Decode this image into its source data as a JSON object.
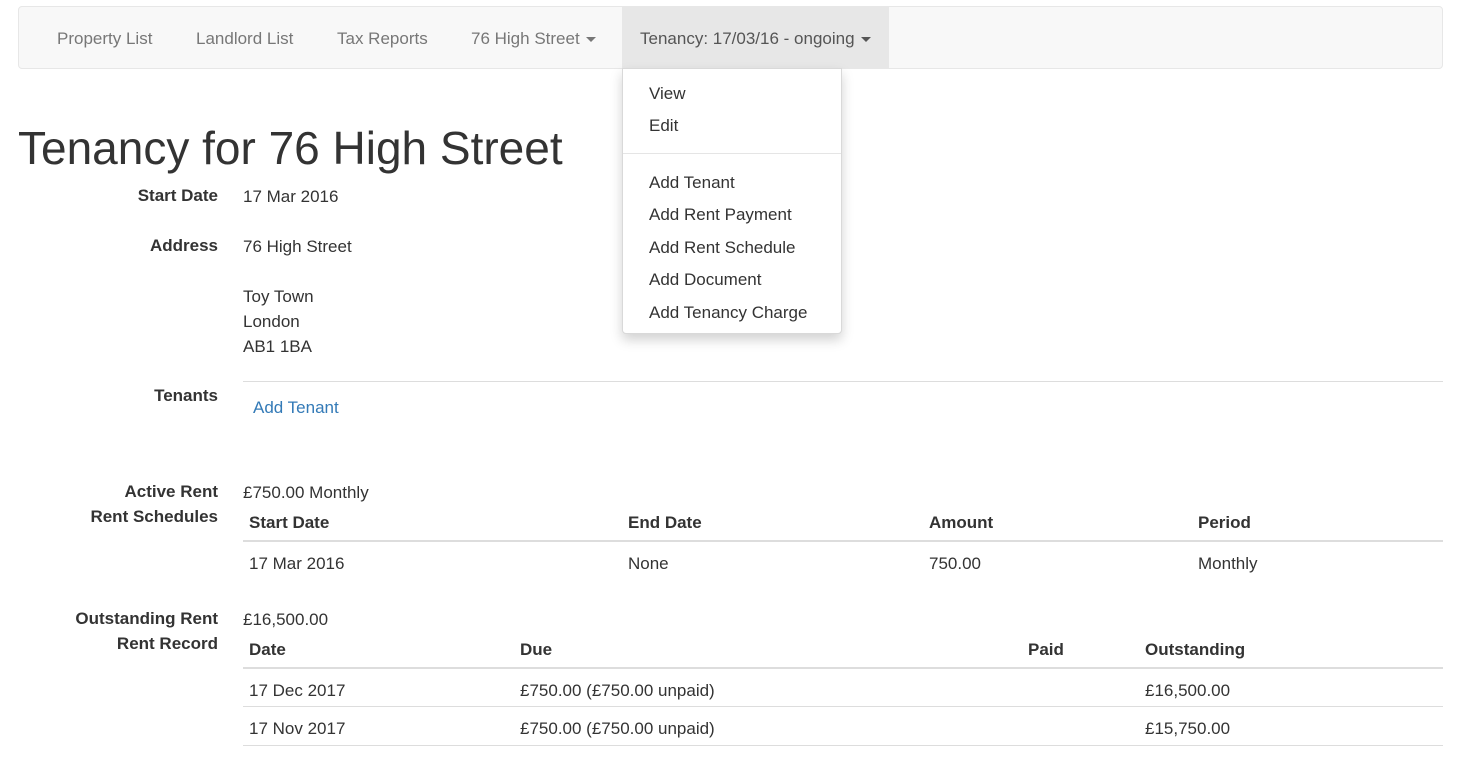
{
  "nav": {
    "items": [
      {
        "label": "Property List"
      },
      {
        "label": "Landlord List"
      },
      {
        "label": "Tax Reports"
      },
      {
        "label": "76 High Street"
      },
      {
        "label": "Tenancy: 17/03/16 - ongoing"
      }
    ]
  },
  "dropdown": {
    "items": [
      {
        "label": "View"
      },
      {
        "label": "Edit"
      },
      {
        "label": "Add Tenant"
      },
      {
        "label": "Add Rent Payment"
      },
      {
        "label": "Add Rent Schedule"
      },
      {
        "label": "Add Document"
      },
      {
        "label": "Add Tenancy Charge"
      }
    ]
  },
  "page": {
    "title": "Tenancy for 76 High Street",
    "start_date_label": "Start Date",
    "start_date": "17 Mar 2016",
    "address_label": "Address",
    "address": [
      "76 High Street",
      "Toy Town",
      "London",
      "AB1 1BA"
    ],
    "tenants_label": "Tenants",
    "add_tenant_link": "Add Tenant",
    "active_rent_label": "Active Rent",
    "active_rent": "£750.00 Monthly",
    "rent_schedules_label": "Rent Schedules",
    "outstanding_rent_label": "Outstanding Rent",
    "outstanding_rent": "£16,500.00",
    "rent_record_label": "Rent Record"
  },
  "schedules": {
    "headers": [
      "Start Date",
      "End Date",
      "Amount",
      "Period"
    ],
    "rows": [
      [
        "17 Mar 2016",
        "None",
        "750.00",
        "Monthly"
      ]
    ]
  },
  "records": {
    "headers": [
      "Date",
      "Due",
      "Paid",
      "Outstanding"
    ],
    "rows": [
      [
        "17 Dec 2017",
        "£750.00 (£750.00 unpaid)",
        "",
        "£16,500.00"
      ],
      [
        "17 Nov 2017",
        "£750.00 (£750.00 unpaid)",
        "",
        "£15,750.00"
      ]
    ]
  }
}
